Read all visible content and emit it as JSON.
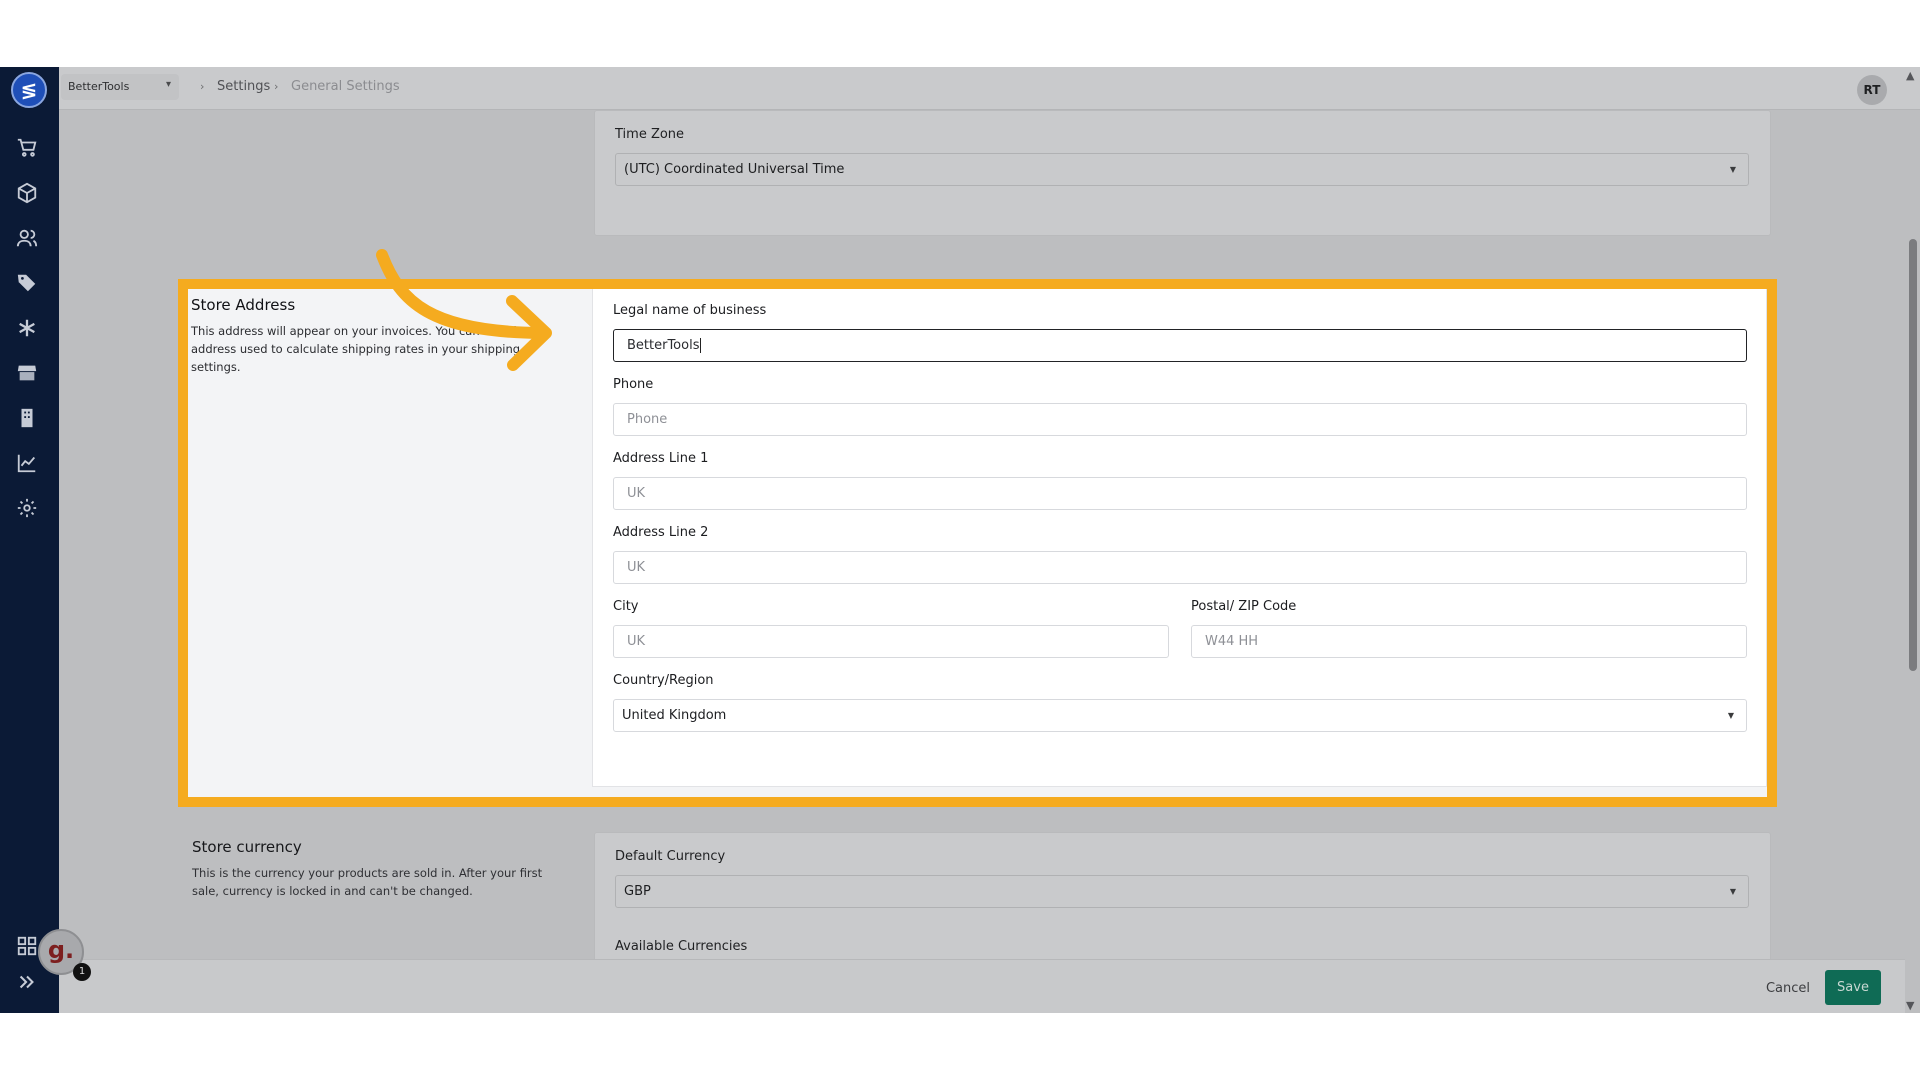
{
  "topbar": {
    "store_name": "BetterTools",
    "breadcrumb": [
      "Settings",
      "General Settings"
    ],
    "avatar_initials": "RT"
  },
  "sidebar": {
    "items": [
      {
        "icon": "cart-icon",
        "label": ""
      },
      {
        "icon": "box-icon",
        "label": ""
      },
      {
        "icon": "users-icon",
        "label": ""
      },
      {
        "icon": "tags-icon",
        "label": ""
      },
      {
        "icon": "asterisk-icon",
        "label": ""
      },
      {
        "icon": "store-icon",
        "label": ""
      },
      {
        "icon": "building-icon",
        "label": ""
      },
      {
        "icon": "chart-icon",
        "label": ""
      },
      {
        "icon": "gear-icon",
        "label": ""
      }
    ],
    "bottom": [
      "grid-icon",
      "expand-icon"
    ]
  },
  "timezone": {
    "label": "Time Zone",
    "value": "(UTC) Coordinated Universal Time"
  },
  "store_address": {
    "title": "Store Address",
    "description": "This address will appear on your invoices. You can edit the address used to calculate shipping rates in your shipping settings.",
    "fields": {
      "legal_name": {
        "label": "Legal name of business",
        "value": "BetterTools"
      },
      "phone": {
        "label": "Phone",
        "placeholder": "Phone"
      },
      "address1": {
        "label": "Address Line 1",
        "placeholder": "UK"
      },
      "address2": {
        "label": "Address Line 2",
        "placeholder": "UK"
      },
      "city": {
        "label": "City",
        "placeholder": "UK"
      },
      "postal": {
        "label": "Postal/ ZIP Code",
        "placeholder": "W44 HH"
      },
      "country": {
        "label": "Country/Region",
        "value": "United Kingdom"
      }
    }
  },
  "store_currency": {
    "title": "Store currency",
    "description": "This is the currency your products are sold in. After your first sale, currency is locked in and can't be changed.",
    "default_label": "Default Currency",
    "default_value": "GBP",
    "available_label": "Available Currencies"
  },
  "footer": {
    "cancel_label": "Cancel",
    "save_label": "Save"
  },
  "widget": {
    "letter": "g.",
    "badge": "1"
  },
  "colors": {
    "sidebar_bg": "#0b1a36",
    "highlight": "#f5ab1f",
    "save_button": "#0f6b55",
    "overlay": "#bdbec0"
  }
}
